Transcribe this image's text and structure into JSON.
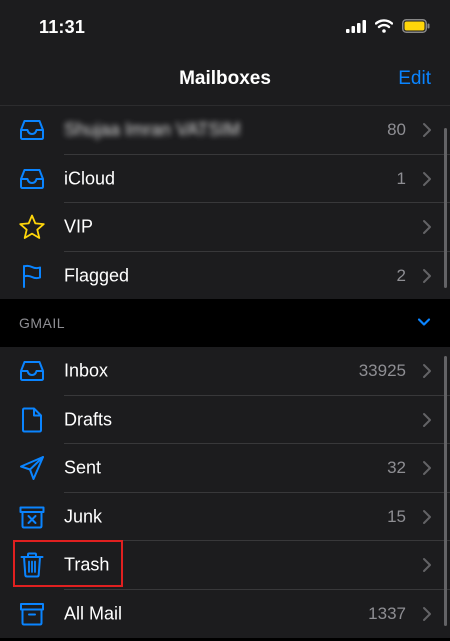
{
  "status_bar": {
    "time": "11:31"
  },
  "nav": {
    "title": "Mailboxes",
    "edit": "Edit"
  },
  "accounts": [
    {
      "label": "Shujaa Imran VATSIM",
      "count": "80",
      "icon": "inbox-tray-icon",
      "blurred": true
    },
    {
      "label": "iCloud",
      "count": "1",
      "icon": "inbox-tray-icon"
    },
    {
      "label": "VIP",
      "count": "",
      "icon": "star-icon"
    },
    {
      "label": "Flagged",
      "count": "2",
      "icon": "flag-icon"
    }
  ],
  "gmail_section": {
    "label": "GMAIL",
    "icon": "chevron-down-icon"
  },
  "gmail": [
    {
      "label": "Inbox",
      "count": "33925",
      "icon": "inbox-tray-icon"
    },
    {
      "label": "Drafts",
      "count": "",
      "icon": "document-icon"
    },
    {
      "label": "Sent",
      "count": "32",
      "icon": "paper-plane-icon"
    },
    {
      "label": "Junk",
      "count": "15",
      "icon": "junk-bin-icon"
    },
    {
      "label": "Trash",
      "count": "",
      "icon": "trash-icon",
      "highlighted": true
    },
    {
      "label": "All Mail",
      "count": "1337",
      "icon": "archive-box-icon"
    }
  ],
  "colors": {
    "accent": "#0a84ff",
    "star": "#ffd60a",
    "highlight": "#e02020",
    "background": "#1c1c1e"
  }
}
